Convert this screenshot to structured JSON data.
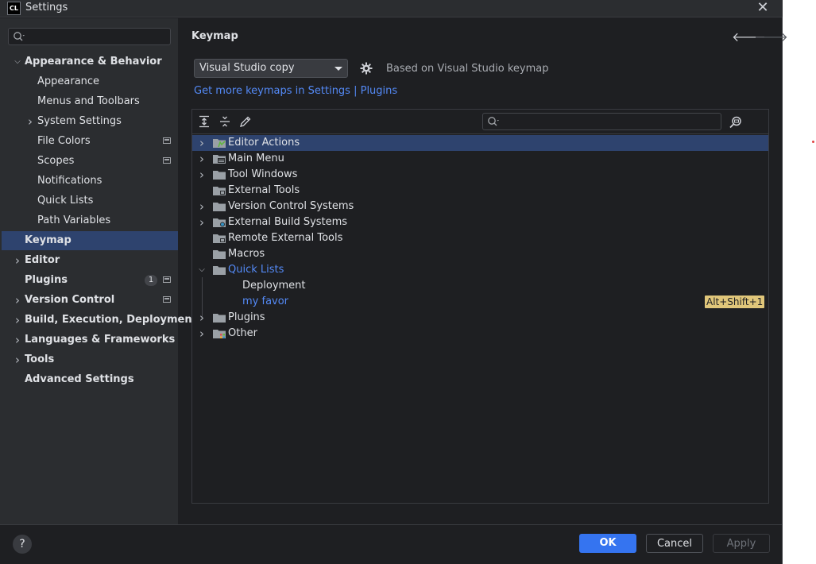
{
  "window": {
    "app_logo": "CL",
    "title": "Settings",
    "close": "✕"
  },
  "sidebar": {
    "search_placeholder": "",
    "items": [
      {
        "label": "Appearance & Behavior",
        "chevron": "expanded",
        "level": 0,
        "bold": true
      },
      {
        "label": "Appearance",
        "level": 1
      },
      {
        "label": "Menus and Toolbars",
        "level": 1
      },
      {
        "label": "System Settings",
        "chevron": "collapsed",
        "level": 1
      },
      {
        "label": "File Colors",
        "level": 1,
        "project_icon": true
      },
      {
        "label": "Scopes",
        "level": 1,
        "project_icon": true
      },
      {
        "label": "Notifications",
        "level": 1
      },
      {
        "label": "Quick Lists",
        "level": 1
      },
      {
        "label": "Path Variables",
        "level": 1
      },
      {
        "label": "Keymap",
        "level": 0,
        "bold": true,
        "selected": true
      },
      {
        "label": "Editor",
        "chevron": "collapsed",
        "level": 0,
        "bold": true
      },
      {
        "label": "Plugins",
        "level": 0,
        "bold": true,
        "badge": "1",
        "project_icon": true
      },
      {
        "label": "Version Control",
        "chevron": "collapsed",
        "level": 0,
        "bold": true,
        "project_icon": true
      },
      {
        "label": "Build, Execution, Deployment",
        "chevron": "collapsed",
        "level": 0,
        "bold": true
      },
      {
        "label": "Languages & Frameworks",
        "chevron": "collapsed",
        "level": 0,
        "bold": true
      },
      {
        "label": "Tools",
        "chevron": "collapsed",
        "level": 0,
        "bold": true
      },
      {
        "label": "Advanced Settings",
        "level": 0,
        "bold": true
      }
    ]
  },
  "content": {
    "title": "Keymap",
    "back_arrow": "🡐",
    "forward_arrow": "🡒",
    "keymap_value": "Visual Studio copy",
    "based_on": "Based on Visual Studio keymap",
    "more_keymaps_link": "Get more keymaps in Settings | Plugins",
    "tree_search_placeholder": ""
  },
  "tree": [
    {
      "label": "Editor Actions",
      "chevron": "collapsed",
      "icon": "folder-actions",
      "selected": true,
      "level": 0
    },
    {
      "label": "Main Menu",
      "chevron": "collapsed",
      "icon": "folder-menu",
      "level": 0
    },
    {
      "label": "Tool Windows",
      "chevron": "collapsed",
      "icon": "folder",
      "level": 0
    },
    {
      "label": "External Tools",
      "icon": "folder-tools",
      "level": 0
    },
    {
      "label": "Version Control Systems",
      "chevron": "collapsed",
      "icon": "folder",
      "level": 0
    },
    {
      "label": "External Build Systems",
      "chevron": "collapsed",
      "icon": "folder-build",
      "level": 0
    },
    {
      "label": "Remote External Tools",
      "icon": "folder-tools",
      "level": 0
    },
    {
      "label": "Macros",
      "icon": "folder",
      "level": 0
    },
    {
      "label": "Quick Lists",
      "chevron": "expanded",
      "icon": "folder",
      "level": 0,
      "link": true
    },
    {
      "label": "Deployment",
      "level": 1
    },
    {
      "label": "my favor",
      "level": 1,
      "link": true,
      "shortcut": "Alt+Shift+1"
    },
    {
      "label": "Plugins",
      "chevron": "collapsed",
      "icon": "folder",
      "level": 0
    },
    {
      "label": "Other",
      "chevron": "collapsed",
      "icon": "folder-other",
      "level": 0
    }
  ],
  "buttons": {
    "help": "?",
    "ok": "OK",
    "cancel": "Cancel",
    "apply": "Apply"
  },
  "colors": {
    "accent": "#3574f0",
    "selection": "#2e436e",
    "link": "#548af7",
    "shortcut_badge": "#e0c67a"
  }
}
